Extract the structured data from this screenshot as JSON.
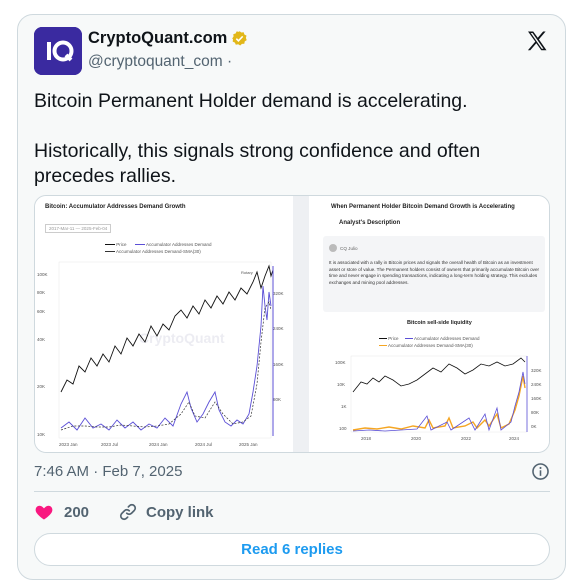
{
  "author": {
    "display_name": "CryptoQuant.com",
    "handle": "@cryptoquant_com ·",
    "avatar_icon": "cryptoquant-logo",
    "verified_badge_icon": "verified-gold-badge-icon"
  },
  "platform_icon": "x-logo-icon",
  "tweet": {
    "paragraph_1": "Bitcoin Permanent Holder demand is accelerating.",
    "paragraph_2": "Historically, this signals strong confidence and often precedes rallies."
  },
  "media": {
    "left_chart": {
      "title": "Bitcoin: Accumulator Addresses Demand Growth",
      "date_range": "2017-Mar-11 — 2025-Feb-04",
      "watermark": "CryptoQuant",
      "annotation": "Rotary",
      "legend": [
        "Price",
        "Accumulator Addresses Demand",
        "Accumulator Addresses Demand-SMA(30)"
      ],
      "y_left_ticks": [
        "100K",
        "80K",
        "60K",
        "40K",
        "20K",
        "10K"
      ],
      "y_right_ticks": [
        "320K",
        "240K",
        "160K",
        "80K"
      ],
      "x_ticks": [
        "2023 Jan",
        "2023 Jul",
        "2024 Jan",
        "2024 Jul",
        "2025 Jan"
      ]
    },
    "right_panel": {
      "title": "When Permanent Holder Bitcoin Demand Growth is Accelerating",
      "section_heading": "Analyst's Description",
      "author": "CQ Julio",
      "description": "It is associated with a rally in Bitcoin prices and signals the overall health of Bitcoin as an investment asset or store of value. The Permanent holders consist of owners that primarily accumulate Bitcoin over time and never engage in spending transactions, indicating a long-term holding strategy. This excludes exchanges and mining pool addresses.",
      "chart_title": "Bitcoin sell-side liquidity",
      "legend": [
        "Price",
        "Accumulator Addresses Demand",
        "Accumulator Addresses Demand-SMA(30)"
      ],
      "y_left_ticks": [
        "100K",
        "10K",
        "1K",
        "100"
      ],
      "y_right_ticks": [
        "320K",
        "240K",
        "160K",
        "80K",
        "0K"
      ],
      "x_ticks": [
        "2018",
        "2020",
        "2022",
        "2024"
      ]
    }
  },
  "meta": {
    "timestamp": "7:46 AM · Feb 7, 2025",
    "info_icon": "info-circle-icon"
  },
  "actions": {
    "like_count": "200",
    "like_icon": "heart-icon",
    "copy_link_label": "Copy link",
    "copy_link_icon": "link-icon"
  },
  "replies_button_label": "Read 6 replies",
  "colors": {
    "accent_blue": "#1d9bf0",
    "heart_red": "#f91880",
    "brand_purple": "#3a2aa0",
    "chart_line_purple": "#5b4fd6",
    "chart_sma_orange": "#f5a623"
  }
}
